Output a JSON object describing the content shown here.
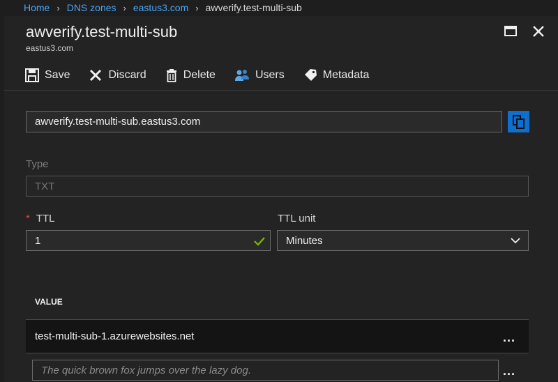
{
  "breadcrumb": {
    "items": [
      "Home",
      "DNS zones",
      "eastus3.com"
    ],
    "current": "awverify.test-multi-sub"
  },
  "blade": {
    "title": "awverify.test-multi-sub",
    "subtitle": "eastus3.com"
  },
  "toolbar": {
    "save": "Save",
    "discard": "Discard",
    "delete": "Delete",
    "users": "Users",
    "metadata": "Metadata"
  },
  "form": {
    "fqdn": "awverify.test-multi-sub.eastus3.com",
    "type_label": "Type",
    "type_value": "TXT",
    "ttl_required_mark": "*",
    "ttl_label": "TTL",
    "ttl_value": "1",
    "ttl_unit_label": "TTL unit",
    "ttl_unit_value": "Minutes"
  },
  "values": {
    "header": "VALUE",
    "rows": [
      "test-multi-sub-1.azurewebsites.net"
    ],
    "new_placeholder": "The quick brown fox jumps over the lazy dog.",
    "more_label": "..."
  },
  "colors": {
    "link": "#4aa3f0",
    "accent": "#0f6fd1",
    "required": "#e0443e",
    "valid": "#7fba00"
  }
}
